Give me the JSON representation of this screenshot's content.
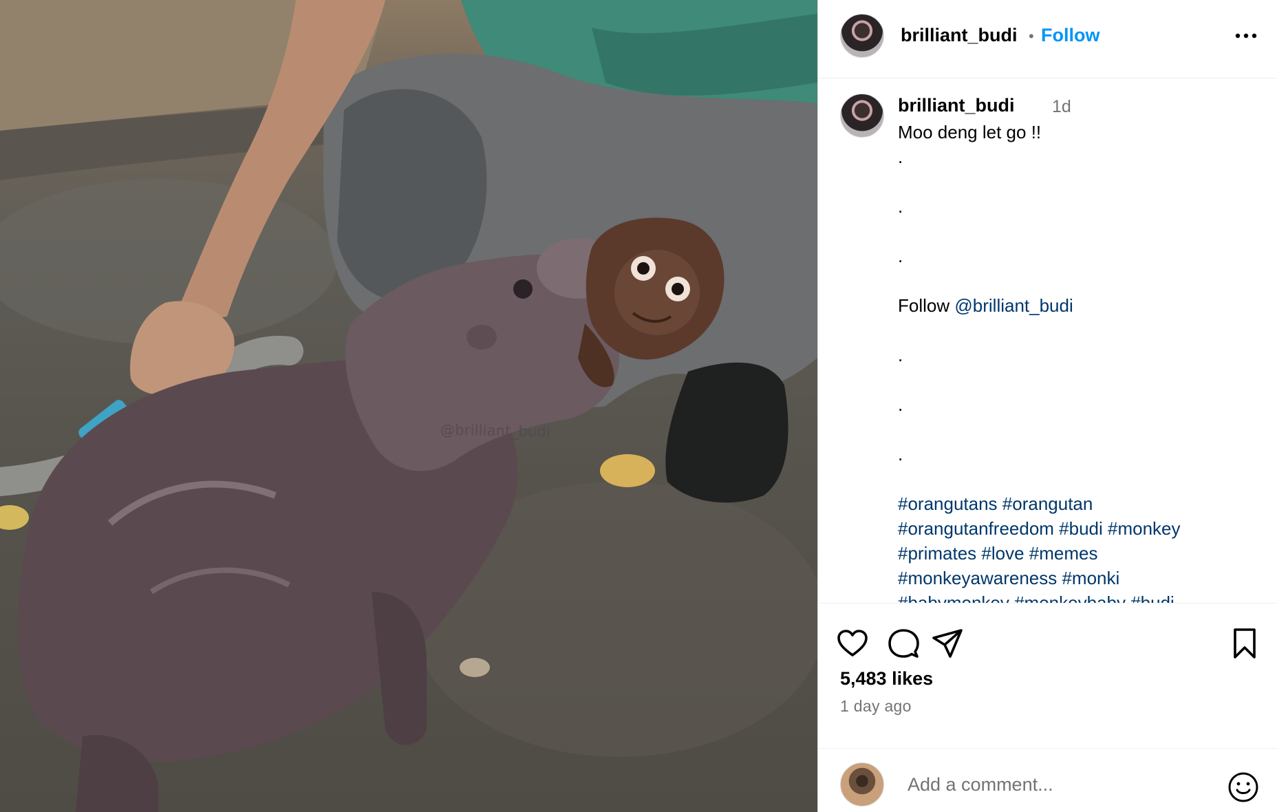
{
  "media": {
    "watermark": "@brilliant_budi"
  },
  "header": {
    "username": "brilliant_budi",
    "separator": "•",
    "follow_label": "Follow",
    "more_icon": "more-horizontal-icon"
  },
  "caption": {
    "username": "brilliant_budi",
    "time": "1d",
    "text": "Moo deng let go !!",
    "dots": [
      ".",
      ".",
      ".",
      ".",
      ".",
      "."
    ],
    "follow_prefix": "Follow",
    "follow_handle": "@brilliant_budi",
    "hashtag_lines": [
      "#orangutans #orangutan",
      "#orangutanfreedom #budi #monkey",
      "#primates #love #memes",
      "#monkeyawareness #monki",
      "#babymonkey #monkeybaby #budi"
    ]
  },
  "actions": {
    "icons": [
      "heart-icon",
      "comment-icon",
      "share-icon",
      "bookmark-icon"
    ],
    "likes": "5,483 likes",
    "posted_ago": "1 day ago"
  },
  "comment": {
    "placeholder": "Add a comment...",
    "emoji_icon": "emoji-icon"
  },
  "colors": {
    "follow": "#0095f6",
    "link": "#00376b",
    "muted": "#737373",
    "divider": "#efefef"
  }
}
